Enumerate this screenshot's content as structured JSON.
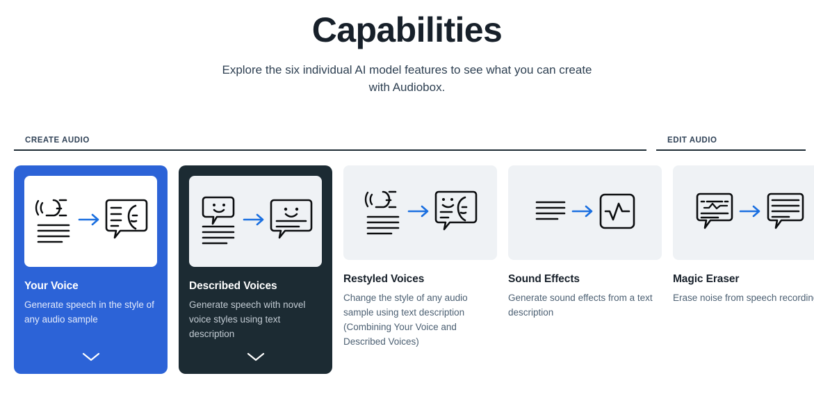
{
  "header": {
    "title": "Capabilities",
    "subtitle": "Explore the six individual AI model features to see what you can create with Audiobox."
  },
  "sections": [
    {
      "id": "create-audio",
      "label": "CREATE AUDIO"
    },
    {
      "id": "edit-audio",
      "label": "EDIT AUDIO"
    }
  ],
  "colors": {
    "accent_blue": "#2c63d7",
    "dark_navy": "#1c2b33",
    "panel_gray": "#eff2f5",
    "arrow_blue": "#1a6fe0",
    "text_dark": "#17202a"
  },
  "cards": [
    {
      "id": "your-voice",
      "title": "Your Voice",
      "description": "Generate speech in the style of any audio sample",
      "style": "blue-filled",
      "expanded": false,
      "chevron": "chevron-down-icon",
      "icons": {
        "from": "speaking-face-with-lines-icon",
        "arrow": "arrow-right-icon",
        "to": "speech-bubble-with-face-icon"
      }
    },
    {
      "id": "described-voices",
      "title": "Described Voices",
      "description": "Generate speech with novel voice styles using text description",
      "style": "dark-filled",
      "expanded": false,
      "chevron": "chevron-down-icon",
      "icons": {
        "from": "smiley-bubble-with-lines-icon",
        "arrow": "arrow-right-icon",
        "to": "speech-bubble-smiley-text-icon"
      }
    },
    {
      "id": "restyled-voices",
      "title": "Restyled Voices",
      "description": "Change the style of any audio sample using text description (Combining Your Voice and Described Voices)",
      "style": "plain",
      "expanded": false,
      "chevron": null,
      "icons": {
        "from": "speaking-face-with-lines-icon",
        "arrow": "arrow-right-icon",
        "to": "speech-bubble-smiley-face-icon"
      }
    },
    {
      "id": "sound-effects",
      "title": "Sound Effects",
      "description": "Generate sound effects from a text description",
      "style": "plain",
      "expanded": false,
      "chevron": null,
      "icons": {
        "from": "text-lines-icon",
        "arrow": "arrow-right-icon",
        "to": "waveform-box-icon"
      }
    },
    {
      "id": "magic-eraser",
      "title": "Magic Eraser",
      "description": "Erase noise from speech recordings",
      "style": "plain",
      "expanded": false,
      "chevron": null,
      "icons": {
        "from": "noisy-speech-bubble-icon",
        "arrow": "arrow-right-icon",
        "to": "clean-speech-bubble-icon"
      }
    }
  ]
}
